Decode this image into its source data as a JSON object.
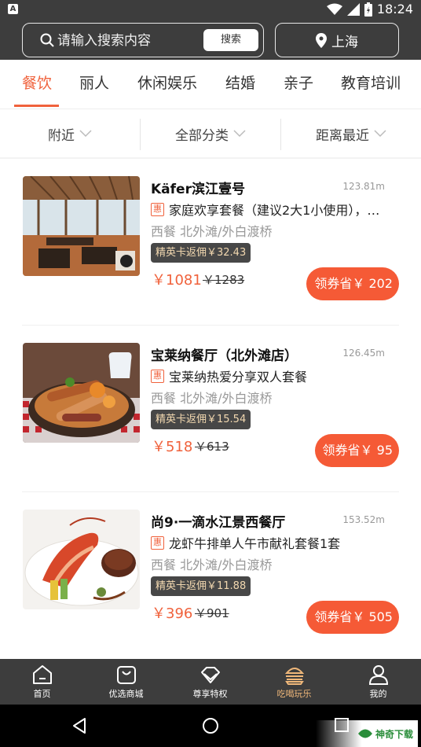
{
  "status_bar": {
    "time": "18:24"
  },
  "header": {
    "search_placeholder": "请输入搜索内容",
    "search_button": "搜索",
    "city": "上海"
  },
  "categories": [
    {
      "label": "餐饮",
      "active": true
    },
    {
      "label": "丽人"
    },
    {
      "label": "休闲娱乐"
    },
    {
      "label": "结婚"
    },
    {
      "label": "亲子"
    },
    {
      "label": "教育培训"
    }
  ],
  "filters": [
    "附近",
    "全部分类",
    "距离最近"
  ],
  "deal_badge": "惠",
  "listings": [
    {
      "name": "Käfer滨江壹号",
      "distance": "123.81m",
      "deal": "家庭欢享套餐（建议2大1小使用），…",
      "location": "西餐  北外滩/外白渡桥",
      "rebate": "精英卡返佣￥32.43",
      "price": "￥1081",
      "original_price": "￥1283",
      "coupon": "领券省￥ 202"
    },
    {
      "name": "宝莱纳餐厅（北外滩店）",
      "distance": "126.45m",
      "deal": "宝莱纳热爱分享双人套餐",
      "location": "西餐  北外滩/外白渡桥",
      "rebate": "精英卡返佣￥15.54",
      "price": "￥518",
      "original_price": "￥613",
      "coupon": "领券省￥ 95"
    },
    {
      "name": "尚9·一滴水江景西餐厅",
      "distance": "153.52m",
      "deal": "龙虾牛排单人午市献礼套餐1套",
      "location": "西餐  北外滩/外白渡桥",
      "rebate": "精英卡返佣￥11.88",
      "price": "￥396",
      "original_price": "￥901",
      "coupon": "领券省￥ 505"
    }
  ],
  "bottom_nav": [
    {
      "label": "首页",
      "icon": "home-icon"
    },
    {
      "label": "优选商城",
      "icon": "shopping-bag-icon"
    },
    {
      "label": "尊享特权",
      "icon": "diamond-icon"
    },
    {
      "label": "吃喝玩乐",
      "icon": "burger-icon",
      "active": true
    },
    {
      "label": "我的",
      "icon": "person-icon"
    }
  ],
  "watermark": "神奇下载",
  "colors": {
    "accent": "#f0623c",
    "coupon": "#f55a36",
    "header_bg": "#3d3d3d",
    "active_nav": "#f0b87a"
  }
}
